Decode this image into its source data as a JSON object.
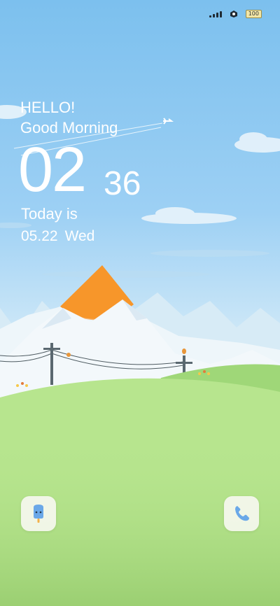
{
  "status_bar": {
    "signal_icon": "signal-bars-icon",
    "status_icon": "data-activity-icon",
    "battery": "100"
  },
  "clock": {
    "greeting_1": "HELLO!",
    "greeting_2": "Good Morning",
    "hours": "02",
    "minutes": "36",
    "today_label": "Today is",
    "date": "05.22",
    "weekday": "Wed"
  },
  "shortcuts": {
    "left_icon": "popsicle-icon",
    "right_icon": "phone-icon"
  },
  "colors": {
    "sky": "#7cc0ee",
    "hill": "#b7e58e",
    "sun": "#f7962a"
  }
}
